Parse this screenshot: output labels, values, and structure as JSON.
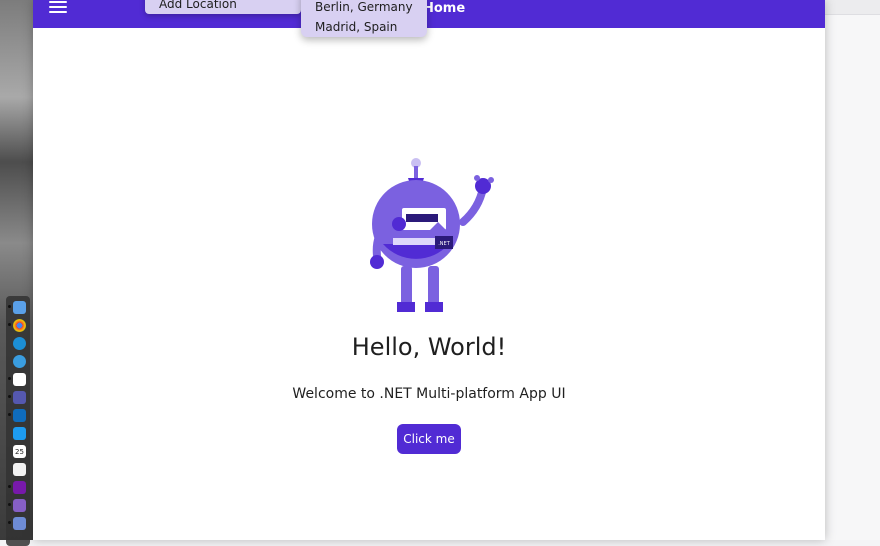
{
  "app": {
    "nav_title": "Home",
    "menu_add_label": "Add Location",
    "locations": [
      "Berlin, Germany",
      "Madrid, Spain"
    ]
  },
  "main": {
    "heading": "Hello, World!",
    "subtitle": "Welcome to .NET Multi-platform App UI",
    "button_label": "Click me",
    "bot_badge": ".NET"
  },
  "dock": {
    "items": [
      "finder-icon",
      "chrome-icon",
      "edge-icon",
      "safari-icon",
      "slack-icon",
      "teams-icon",
      "outlook-icon",
      "twitter-icon",
      "calendar-icon",
      "notes-icon",
      "onenote-icon",
      "visual-studio-icon",
      "app-icon"
    ],
    "calendar_day": "25"
  },
  "colors": {
    "accent": "#512bd4",
    "menu_bg": "#d8d0f2",
    "bot_main": "#7b61e0",
    "bot_dark": "#512bd4"
  }
}
